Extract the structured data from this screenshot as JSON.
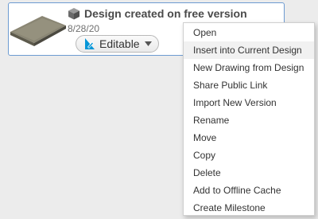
{
  "design_card": {
    "title": "Design created on free version",
    "date": "8/28/20",
    "status": {
      "label": "Editable"
    },
    "icons": {
      "type": "cube-icon",
      "status": "pencil-icon",
      "dropdown": "chevron-down-icon"
    },
    "colors": {
      "card_border": "#6d9bd1",
      "accent": "#0696d7"
    }
  },
  "context_menu": {
    "items": [
      {
        "label": "Open"
      },
      {
        "label": "Insert into Current Design"
      },
      {
        "label": "New Drawing from Design"
      },
      {
        "label": "Share Public Link"
      },
      {
        "label": "Import New Version"
      },
      {
        "label": "Rename"
      },
      {
        "label": "Move"
      },
      {
        "label": "Copy"
      },
      {
        "label": "Delete"
      },
      {
        "label": "Add to Offline Cache"
      },
      {
        "label": "Create Milestone"
      }
    ],
    "hovered_item": "Insert into Current Design"
  }
}
